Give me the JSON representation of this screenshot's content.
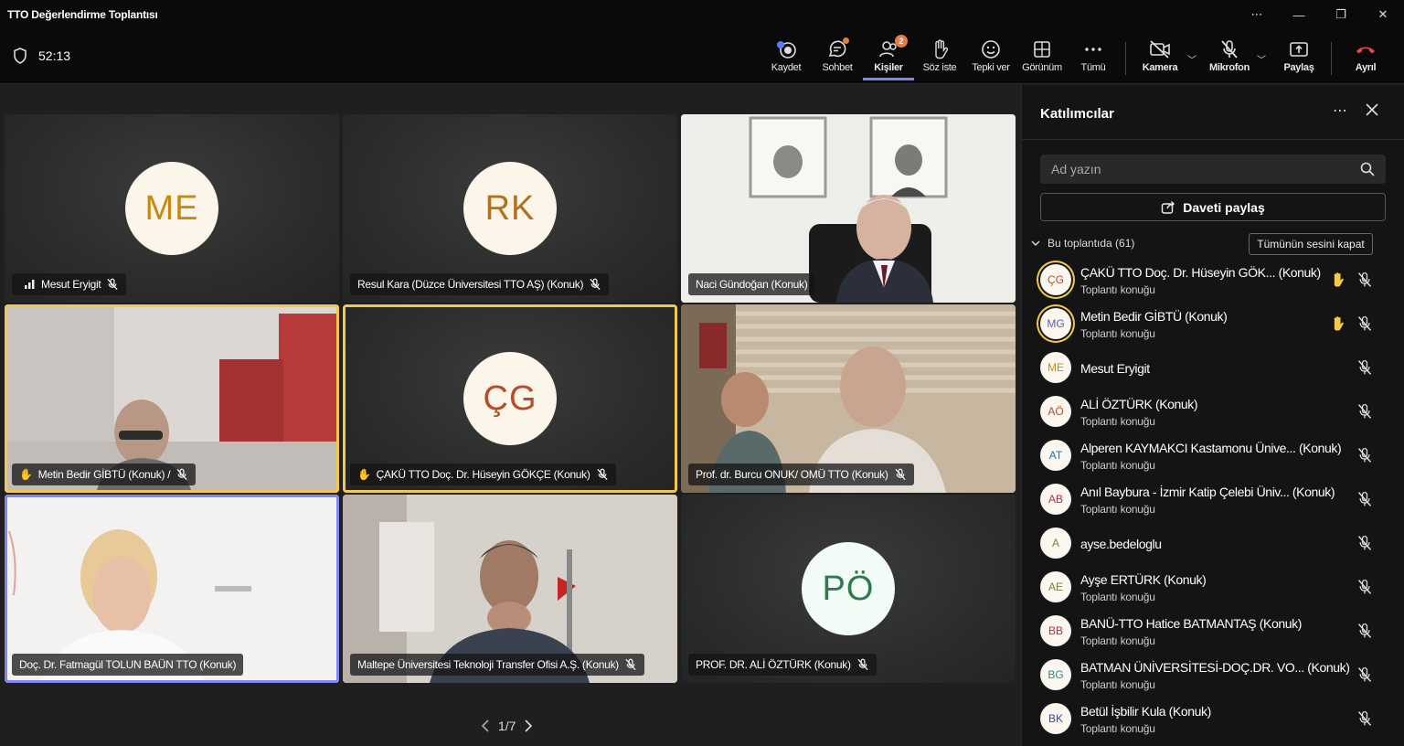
{
  "window": {
    "title": "TTO Değerlendirme Toplantısı",
    "controls": [
      "⋯",
      "—",
      "❐",
      "✕"
    ]
  },
  "toolbar": {
    "timer": "52:13",
    "buttons": [
      {
        "name": "record",
        "label": "Kaydet"
      },
      {
        "name": "chat",
        "label": "Sohbet"
      },
      {
        "name": "people",
        "label": "Kişiler",
        "badge": "2"
      },
      {
        "name": "raise-hand",
        "label": "Söz iste"
      },
      {
        "name": "react",
        "label": "Tepki ver"
      },
      {
        "name": "view",
        "label": "Görünüm"
      },
      {
        "name": "more",
        "label": "Tümü"
      },
      {
        "name": "camera",
        "label": "Kamera"
      },
      {
        "name": "mic",
        "label": "Mikrofon"
      },
      {
        "name": "share",
        "label": "Paylaş"
      },
      {
        "name": "leave",
        "label": "Ayrıl"
      }
    ]
  },
  "tiles": [
    {
      "initials": "ME",
      "name": "Mesut Eryigit",
      "av_bg": "#fbf6e9",
      "av_fg": "#c68a13"
    },
    {
      "initials": "RK",
      "name": "Resul Kara (Düzce Üniversitesi TTO AŞ) (Konuk)",
      "av_bg": "#fbf6e9",
      "av_fg": "#b1721d"
    },
    {
      "name": "Naci Gündoğan (Konuk)"
    },
    {
      "name": "Metin Bedir GİBTÜ (Konuk) /"
    },
    {
      "initials": "ÇG",
      "name": "ÇAKÜ TTO Doç. Dr. Hüseyin GÖKÇE (Konuk)",
      "av_bg": "#fbf6e9",
      "av_fg": "#b74c2a"
    },
    {
      "name": "Prof. dr. Burcu ONUK/ OMÜ TTO (Konuk)"
    },
    {
      "name": "Doç. Dr. Fatmagül TOLUN BAÜN TTO (Konuk)"
    },
    {
      "name": "Maltepe Üniversitesi Teknoloji Transfer Ofisi A.Ş. (Konuk)"
    },
    {
      "initials": "PÖ",
      "name": "PROF. DR. ALİ ÖZTÜRK (Konuk)",
      "av_bg": "#f3fbf6",
      "av_fg": "#2e7a4e"
    }
  ],
  "pager": {
    "label": "1/7"
  },
  "panel": {
    "title": "Katılımcılar",
    "search_placeholder": "Ad yazın",
    "invite_label": "Daveti paylaş",
    "section_label": "Bu toplantıda (61)",
    "mute_all_label": "Tümünün sesini kapat",
    "participants": [
      {
        "initials": "ÇG",
        "name": "ÇAKÜ TTO Doç. Dr. Hüseyin GÖK...  (Konuk)",
        "sub": "Toplantı konuğu",
        "hand": true,
        "ring": true,
        "fg": "#b74c2a"
      },
      {
        "initials": "MG",
        "name": "Metin Bedir GİBTÜ (Konuk)",
        "sub": "Toplantı konuğu",
        "hand": true,
        "ring": true,
        "fg": "#5a5ea8"
      },
      {
        "initials": "ME",
        "name": "Mesut Eryigit",
        "sub": "",
        "hand": false,
        "ring": false,
        "fg": "#c68a13"
      },
      {
        "initials": "AÖ",
        "name": "ALİ ÖZTÜRK (Konuk)",
        "sub": "Toplantı konuğu",
        "hand": false,
        "ring": false,
        "fg": "#b74c2a"
      },
      {
        "initials": "AT",
        "name": "Alperen KAYMAKCI Kastamonu Ünive...  (Konuk)",
        "sub": "Toplantı konuğu",
        "hand": false,
        "ring": false,
        "fg": "#2b6ca3"
      },
      {
        "initials": "AB",
        "name": "Anıl Baybura - İzmir Katip Çelebi Üniv...  (Konuk)",
        "sub": "Toplantı konuğu",
        "hand": false,
        "ring": false,
        "fg": "#a8325a"
      },
      {
        "initials": "A",
        "name": "ayse.bedeloglu",
        "sub": "",
        "hand": false,
        "ring": false,
        "fg": "#6b8a2a"
      },
      {
        "initials": "AE",
        "name": "Ayşe ERTÜRK (Konuk)",
        "sub": "Toplantı konuğu",
        "hand": false,
        "ring": false,
        "fg": "#6b8a2a"
      },
      {
        "initials": "BB",
        "name": "BANÜ-TTO Hatice BATMANTAŞ (Konuk)",
        "sub": "Toplantı konuğu",
        "hand": false,
        "ring": false,
        "fg": "#a8325a"
      },
      {
        "initials": "BG",
        "name": "BATMAN ÜNİVERSİTESİ-DOÇ.DR. VO...  (Konuk)",
        "sub": "Toplantı konuğu",
        "hand": false,
        "ring": false,
        "fg": "#2a8a8a"
      },
      {
        "initials": "BK",
        "name": "Betül İşbilir Kula (Konuk)",
        "sub": "Toplantı konuğu",
        "hand": false,
        "ring": false,
        "fg": "#3a4a8a"
      }
    ]
  }
}
